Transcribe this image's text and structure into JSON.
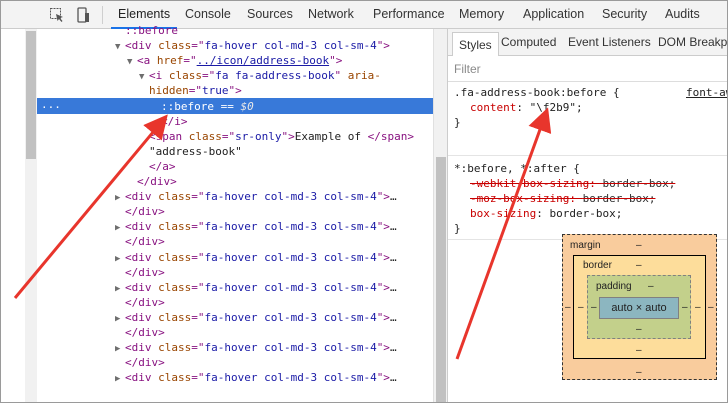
{
  "toolbar": {
    "tabs": [
      "Elements",
      "Console",
      "Sources",
      "Network",
      "Performance",
      "Memory",
      "Application",
      "Security",
      "Audits"
    ],
    "active_tab": "Elements"
  },
  "elements": {
    "lines": [
      {
        "indent": 0,
        "arrow": "",
        "parts": [
          [
            "pseudo",
            "::before"
          ]
        ]
      },
      {
        "indent": 0,
        "arrow": "▼",
        "parts": [
          [
            "tag",
            "<div "
          ],
          [
            "attr",
            "class"
          ],
          [
            "tag",
            "=\""
          ],
          [
            "val",
            "fa-hover col-md-3 col-sm-4"
          ],
          [
            "tag",
            "\">"
          ]
        ]
      },
      {
        "indent": 1,
        "arrow": "▼",
        "parts": [
          [
            "tag",
            "<a "
          ],
          [
            "attr",
            "href"
          ],
          [
            "tag",
            "=\""
          ],
          [
            "link",
            "../icon/address-book"
          ],
          [
            "tag",
            "\">"
          ]
        ]
      },
      {
        "indent": 2,
        "arrow": "▼",
        "parts": [
          [
            "tag",
            "<i "
          ],
          [
            "attr",
            "class"
          ],
          [
            "tag",
            "=\""
          ],
          [
            "val",
            "fa fa-address-book"
          ],
          [
            "tag",
            "\" "
          ],
          [
            "attr",
            "aria-"
          ]
        ]
      },
      {
        "indent": 2,
        "arrow": "",
        "parts": [
          [
            "attr",
            "hidden"
          ],
          [
            "tag",
            "=\""
          ],
          [
            "val",
            "true"
          ],
          [
            "tag",
            "\">"
          ]
        ]
      },
      {
        "indent": 3,
        "arrow": "",
        "selected": true,
        "parts": [
          [
            "pseudo",
            "::before"
          ],
          [
            "eq",
            " == "
          ],
          [
            "zero",
            "$0"
          ]
        ]
      },
      {
        "indent": 3,
        "arrow": "",
        "parts": [
          [
            "tag",
            "</i>"
          ]
        ]
      },
      {
        "indent": 2,
        "arrow": "",
        "parts": [
          [
            "tag",
            "<span "
          ],
          [
            "attr",
            "class"
          ],
          [
            "tag",
            "=\""
          ],
          [
            "val",
            "sr-only"
          ],
          [
            "tag",
            "\">"
          ],
          [
            "txt",
            "Example of "
          ],
          [
            "tag",
            "</span>"
          ]
        ]
      },
      {
        "indent": 2,
        "arrow": "",
        "parts": [
          [
            "txt",
            "\"address-book\""
          ]
        ]
      },
      {
        "indent": 2,
        "arrow": "",
        "parts": [
          [
            "tag",
            "</a>"
          ]
        ]
      },
      {
        "indent": 1,
        "arrow": "",
        "parts": [
          [
            "tag",
            "</div>"
          ]
        ]
      },
      {
        "indent": 0,
        "arrow": "▶",
        "parts": [
          [
            "tag",
            "<div "
          ],
          [
            "attr",
            "class"
          ],
          [
            "tag",
            "=\""
          ],
          [
            "val",
            "fa-hover col-md-3 col-sm-4"
          ],
          [
            "tag",
            "\">"
          ],
          [
            "txt",
            "…"
          ]
        ]
      },
      {
        "indent": 0,
        "arrow": "",
        "parts": [
          [
            "tag",
            "</div>"
          ]
        ]
      },
      {
        "indent": 0,
        "arrow": "▶",
        "parts": [
          [
            "tag",
            "<div "
          ],
          [
            "attr",
            "class"
          ],
          [
            "tag",
            "=\""
          ],
          [
            "val",
            "fa-hover col-md-3 col-sm-4"
          ],
          [
            "tag",
            "\">"
          ],
          [
            "txt",
            "…"
          ]
        ]
      },
      {
        "indent": 0,
        "arrow": "",
        "parts": [
          [
            "tag",
            "</div>"
          ]
        ]
      },
      {
        "indent": 0,
        "arrow": "▶",
        "parts": [
          [
            "tag",
            "<div "
          ],
          [
            "attr",
            "class"
          ],
          [
            "tag",
            "=\""
          ],
          [
            "val",
            "fa-hover col-md-3 col-sm-4"
          ],
          [
            "tag",
            "\">"
          ],
          [
            "txt",
            "…"
          ]
        ]
      },
      {
        "indent": 0,
        "arrow": "",
        "parts": [
          [
            "tag",
            "</div>"
          ]
        ]
      },
      {
        "indent": 0,
        "arrow": "▶",
        "parts": [
          [
            "tag",
            "<div "
          ],
          [
            "attr",
            "class"
          ],
          [
            "tag",
            "=\""
          ],
          [
            "val",
            "fa-hover col-md-3 col-sm-4"
          ],
          [
            "tag",
            "\">"
          ],
          [
            "txt",
            "…"
          ]
        ]
      },
      {
        "indent": 0,
        "arrow": "",
        "parts": [
          [
            "tag",
            "</div>"
          ]
        ]
      },
      {
        "indent": 0,
        "arrow": "▶",
        "parts": [
          [
            "tag",
            "<div "
          ],
          [
            "attr",
            "class"
          ],
          [
            "tag",
            "=\""
          ],
          [
            "val",
            "fa-hover col-md-3 col-sm-4"
          ],
          [
            "tag",
            "\">"
          ],
          [
            "txt",
            "…"
          ]
        ]
      },
      {
        "indent": 0,
        "arrow": "",
        "parts": [
          [
            "tag",
            "</div>"
          ]
        ]
      },
      {
        "indent": 0,
        "arrow": "▶",
        "parts": [
          [
            "tag",
            "<div "
          ],
          [
            "attr",
            "class"
          ],
          [
            "tag",
            "=\""
          ],
          [
            "val",
            "fa-hover col-md-3 col-sm-4"
          ],
          [
            "tag",
            "\">"
          ],
          [
            "txt",
            "…"
          ]
        ]
      },
      {
        "indent": 0,
        "arrow": "",
        "parts": [
          [
            "tag",
            "</div>"
          ]
        ]
      },
      {
        "indent": 0,
        "arrow": "▶",
        "parts": [
          [
            "tag",
            "<div "
          ],
          [
            "attr",
            "class"
          ],
          [
            "tag",
            "=\""
          ],
          [
            "val",
            "fa-hover col-md-3 col-sm-4"
          ],
          [
            "tag",
            "\">"
          ],
          [
            "txt",
            "…"
          ]
        ]
      }
    ],
    "selected_dots": "..."
  },
  "styles": {
    "subtabs": [
      "Styles",
      "Computed",
      "Event Listeners",
      "DOM Breakpo"
    ],
    "active_subtab": "Styles",
    "filter_label": "Filter",
    "rule1": {
      "selector": ".fa-address-book:before {",
      "source": "font-aw",
      "prop": "content",
      "value": "\"\\f2b9\";",
      "close": "}"
    },
    "rule2": {
      "selector": "*:before, *:after {",
      "decl1_prop": "-webkit-box-sizing",
      "decl1_val": "border-box;",
      "decl2_prop": "-moz-box-sizing",
      "decl2_val": "border-box;",
      "decl3_prop": "box-sizing",
      "decl3_val": "border-box;",
      "close": "}"
    }
  },
  "box_model": {
    "margin_label": "margin",
    "border_label": "border",
    "padding_label": "padding",
    "content": "auto × auto",
    "dash": "–"
  },
  "colors": {
    "selection": "#3879d9",
    "arrow": "#e8352c",
    "tab_underline": "#1a73e8"
  }
}
